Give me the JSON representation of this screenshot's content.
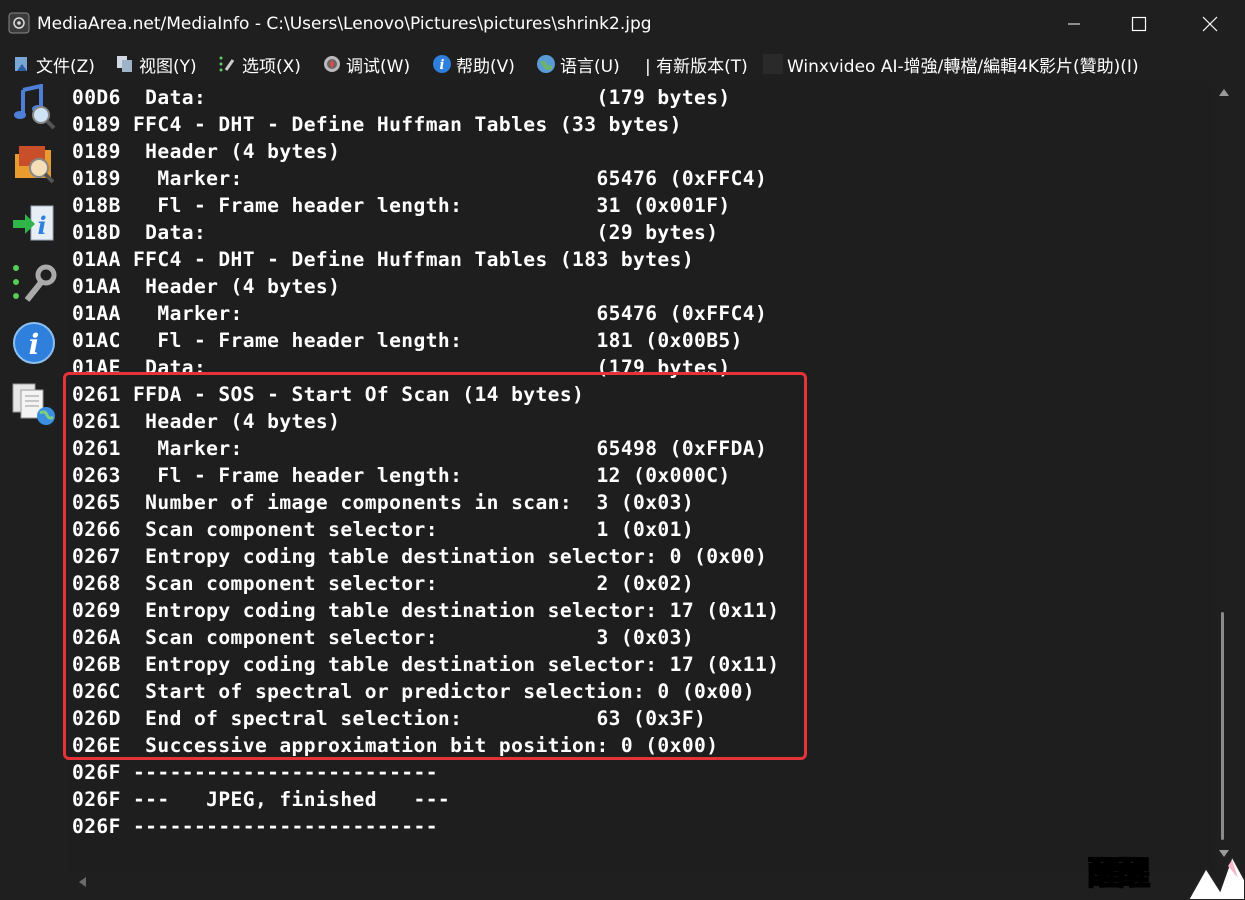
{
  "window": {
    "title": "MediaArea.net/MediaInfo - C:\\Users\\Lenovo\\Pictures\\pictures\\shrink2.jpg"
  },
  "menu": [
    {
      "label": "文件(Z)",
      "icon": "file-icon"
    },
    {
      "label": "视图(Y)",
      "icon": "view-icon"
    },
    {
      "label": "选项(X)",
      "icon": "options-icon"
    },
    {
      "label": "调试(W)",
      "icon": "debug-icon"
    },
    {
      "label": "帮助(V)",
      "icon": "help-icon"
    },
    {
      "label": "语言(U)",
      "icon": "language-icon"
    },
    {
      "label": "| 有新版本(T)",
      "icon": ""
    },
    {
      "label": "Winxvideo AI-增強/轉檔/編輯4K影片(贊助)(I)",
      "icon": "sponsor-icon"
    }
  ],
  "sidebar": [
    {
      "name": "basic-view-icon"
    },
    {
      "name": "sheet-view-icon"
    },
    {
      "name": "export-icon"
    },
    {
      "name": "preferences-icon"
    },
    {
      "name": "about-icon"
    },
    {
      "name": "web-report-icon"
    }
  ],
  "lines": [
    "00D6  Data:                                (179 bytes)",
    "0189 FFC4 - DHT - Define Huffman Tables (33 bytes)",
    "0189  Header (4 bytes)",
    "0189   Marker:                             65476 (0xFFC4)",
    "018B   Fl - Frame header length:           31 (0x001F)",
    "018D  Data:                                (29 bytes)",
    "01AA FFC4 - DHT - Define Huffman Tables (183 bytes)",
    "01AA  Header (4 bytes)",
    "01AA   Marker:                             65476 (0xFFC4)",
    "01AC   Fl - Frame header length:           181 (0x00B5)",
    "01AE  Data:                                (179 bytes)",
    "0261 FFDA - SOS - Start Of Scan (14 bytes)",
    "0261  Header (4 bytes)",
    "0261   Marker:                             65498 (0xFFDA)",
    "0263   Fl - Frame header length:           12 (0x000C)",
    "0265  Number of image components in scan:  3 (0x03)",
    "0266  Scan component selector:             1 (0x01)",
    "0267  Entropy coding table destination selector: 0 (0x00)",
    "0268  Scan component selector:             2 (0x02)",
    "0269  Entropy coding table destination selector: 17 (0x11)",
    "026A  Scan component selector:             3 (0x03)",
    "026B  Entropy coding table destination selector: 17 (0x11)",
    "026C  Start of spectral or predictor selection: 0 (0x00)",
    "026D  End of spectral selection:           63 (0x3F)",
    "026E  Successive approximation bit position: 0 (0x00)",
    "026F -------------------------",
    "026F ---   JPEG, finished   ---",
    "026F -------------------------"
  ],
  "watermark": "醒醒",
  "colors": {
    "background": "#1f1f1f",
    "text": "#ffffff",
    "highlight": "#e6333a"
  }
}
